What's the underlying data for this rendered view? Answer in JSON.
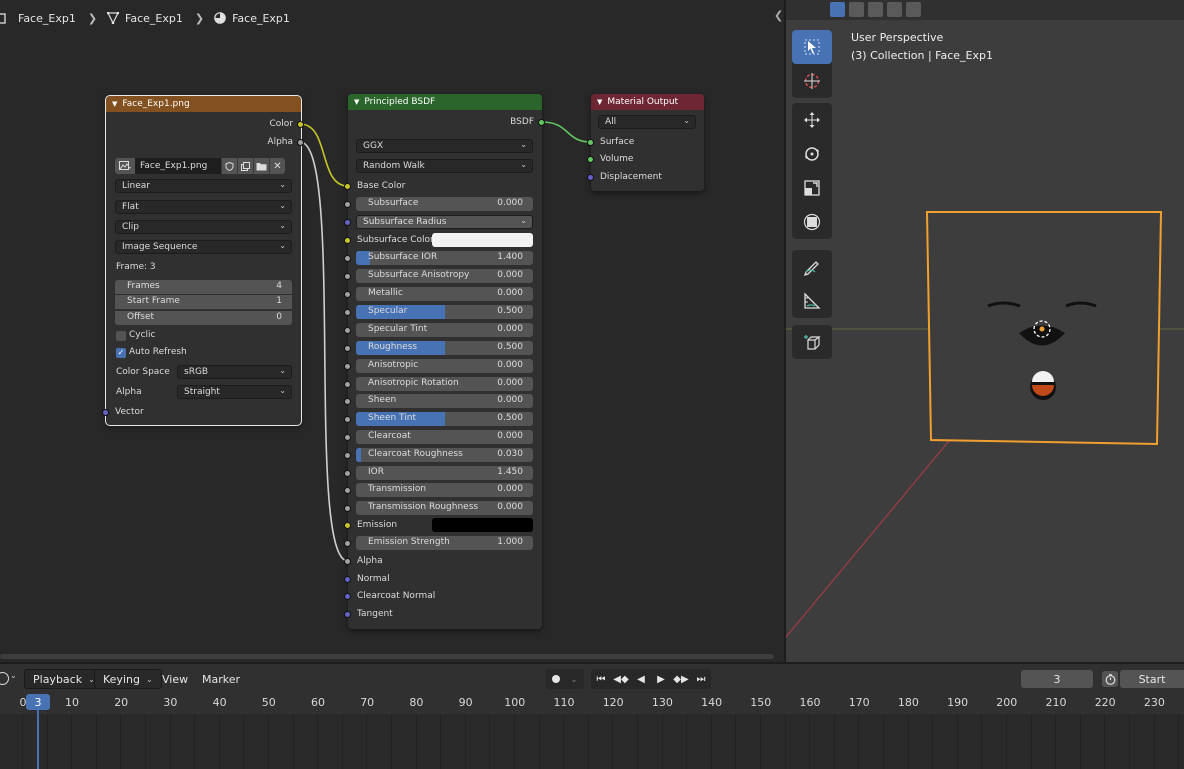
{
  "breadcrumb": {
    "items": [
      {
        "label": "Face_Exp1",
        "icon": "object-icon"
      },
      {
        "label": "Face_Exp1",
        "icon": "mesh-icon"
      },
      {
        "label": "Face_Exp1",
        "icon": "material-icon"
      }
    ]
  },
  "image_node": {
    "title": "Face_Exp1.png",
    "outputs": [
      "Color",
      "Alpha"
    ],
    "image_name": "Face_Exp1.png",
    "interpolation": "Linear",
    "projection": "Flat",
    "extension": "Clip",
    "source": "Image Sequence",
    "frame_label": "Frame: 3",
    "frames_label": "Frames",
    "frames_value": "4",
    "start_frame_label": "Start Frame",
    "start_frame_value": "1",
    "offset_label": "Offset",
    "offset_value": "0",
    "cyclic_label": "Cyclic",
    "auto_refresh_label": "Auto Refresh",
    "color_space_label": "Color Space",
    "color_space_value": "sRGB",
    "alpha_label": "Alpha",
    "alpha_value": "Straight",
    "vector_label": "Vector",
    "header_color": "#83501f"
  },
  "bsdf_node": {
    "title": "Principled BSDF",
    "output": "BSDF",
    "distribution": "GGX",
    "subsurface_method": "Random Walk",
    "base_color_label": "Base Color",
    "subsurface_radius_label": "Subsurface Radius",
    "subsurface_color_label": "Subsurface Color",
    "emission_label": "Emission",
    "alpha_label": "Alpha",
    "normal_label": "Normal",
    "clearcoat_normal_label": "Clearcoat Normal",
    "tangent_label": "Tangent",
    "fields": [
      {
        "label": "Subsurface",
        "value": "0.000",
        "fill": 0
      },
      {
        "label": "Subsurface IOR",
        "value": "1.400",
        "fill": 0.08
      },
      {
        "label": "Subsurface Anisotropy",
        "value": "0.000",
        "fill": 0
      },
      {
        "label": "Metallic",
        "value": "0.000",
        "fill": 0
      },
      {
        "label": "Specular",
        "value": "0.500",
        "fill": 0.5
      },
      {
        "label": "Specular Tint",
        "value": "0.000",
        "fill": 0
      },
      {
        "label": "Roughness",
        "value": "0.500",
        "fill": 0.5
      },
      {
        "label": "Anisotropic",
        "value": "0.000",
        "fill": 0
      },
      {
        "label": "Anisotropic Rotation",
        "value": "0.000",
        "fill": 0
      },
      {
        "label": "Sheen",
        "value": "0.000",
        "fill": 0
      },
      {
        "label": "Sheen Tint",
        "value": "0.500",
        "fill": 0.5
      },
      {
        "label": "Clearcoat",
        "value": "0.000",
        "fill": 0
      },
      {
        "label": "Clearcoat Roughness",
        "value": "0.030",
        "fill": 0.03
      },
      {
        "label": "IOR",
        "value": "1.450",
        "fill": 0
      },
      {
        "label": "Transmission",
        "value": "0.000",
        "fill": 0
      },
      {
        "label": "Transmission Roughness",
        "value": "0.000",
        "fill": 0
      }
    ],
    "emission_strength_label": "Emission Strength",
    "emission_strength_value": "1.000",
    "header_color": "#2b652b"
  },
  "output_node": {
    "title": "Material Output",
    "target": "All",
    "inputs": [
      "Surface",
      "Volume",
      "Displacement"
    ],
    "header_color": "#6e2634"
  },
  "viewport": {
    "view_name": "User Perspective",
    "collection_label": "(3) Collection | Face_Exp1",
    "accent": "#f0a030"
  },
  "timeline": {
    "playback_label": "Playback",
    "keying_label": "Keying",
    "view_label": "View",
    "marker_label": "Marker",
    "current_frame": "3",
    "start_label": "Start",
    "ticks": [
      "0",
      "10",
      "20",
      "30",
      "40",
      "50",
      "60",
      "70",
      "80",
      "90",
      "100",
      "110",
      "120",
      "130",
      "140",
      "150",
      "160",
      "170",
      "180",
      "190",
      "200",
      "210",
      "220",
      "230"
    ]
  }
}
